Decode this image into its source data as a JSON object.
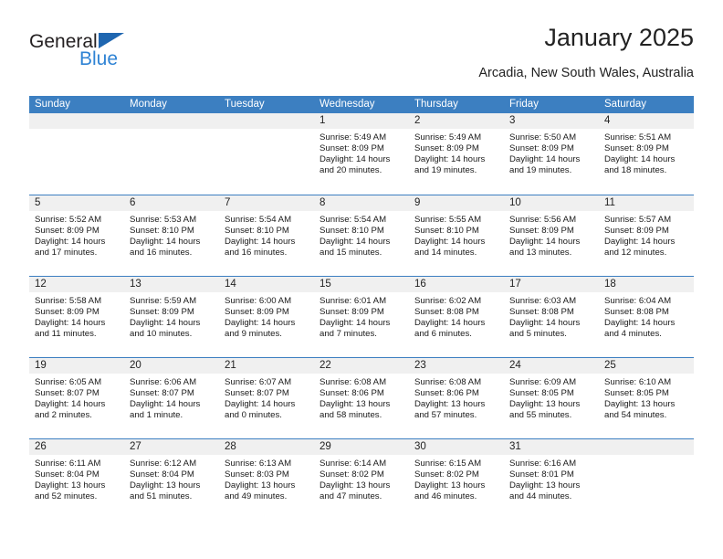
{
  "brand": {
    "word1": "General",
    "word2": "Blue",
    "accent_dark": "#1f66b0",
    "accent_light": "#2f83d4"
  },
  "header": {
    "title": "January 2025",
    "subtitle": "Arcadia, New South Wales, Australia",
    "header_bg": "#3c7fc1"
  },
  "weekdays": [
    "Sunday",
    "Monday",
    "Tuesday",
    "Wednesday",
    "Thursday",
    "Friday",
    "Saturday"
  ],
  "labels": {
    "sunrise": "Sunrise:",
    "sunset": "Sunset:",
    "daylight": "Daylight:"
  },
  "weeks": [
    [
      {
        "day": "",
        "empty": true
      },
      {
        "day": "",
        "empty": true
      },
      {
        "day": "",
        "empty": true
      },
      {
        "day": "1",
        "sunrise": "Sunrise: 5:49 AM",
        "sunset": "Sunset: 8:09 PM",
        "daylight1": "Daylight: 14 hours",
        "daylight2": "and 20 minutes."
      },
      {
        "day": "2",
        "sunrise": "Sunrise: 5:49 AM",
        "sunset": "Sunset: 8:09 PM",
        "daylight1": "Daylight: 14 hours",
        "daylight2": "and 19 minutes."
      },
      {
        "day": "3",
        "sunrise": "Sunrise: 5:50 AM",
        "sunset": "Sunset: 8:09 PM",
        "daylight1": "Daylight: 14 hours",
        "daylight2": "and 19 minutes."
      },
      {
        "day": "4",
        "sunrise": "Sunrise: 5:51 AM",
        "sunset": "Sunset: 8:09 PM",
        "daylight1": "Daylight: 14 hours",
        "daylight2": "and 18 minutes."
      }
    ],
    [
      {
        "day": "5",
        "sunrise": "Sunrise: 5:52 AM",
        "sunset": "Sunset: 8:09 PM",
        "daylight1": "Daylight: 14 hours",
        "daylight2": "and 17 minutes."
      },
      {
        "day": "6",
        "sunrise": "Sunrise: 5:53 AM",
        "sunset": "Sunset: 8:10 PM",
        "daylight1": "Daylight: 14 hours",
        "daylight2": "and 16 minutes."
      },
      {
        "day": "7",
        "sunrise": "Sunrise: 5:54 AM",
        "sunset": "Sunset: 8:10 PM",
        "daylight1": "Daylight: 14 hours",
        "daylight2": "and 16 minutes."
      },
      {
        "day": "8",
        "sunrise": "Sunrise: 5:54 AM",
        "sunset": "Sunset: 8:10 PM",
        "daylight1": "Daylight: 14 hours",
        "daylight2": "and 15 minutes."
      },
      {
        "day": "9",
        "sunrise": "Sunrise: 5:55 AM",
        "sunset": "Sunset: 8:10 PM",
        "daylight1": "Daylight: 14 hours",
        "daylight2": "and 14 minutes."
      },
      {
        "day": "10",
        "sunrise": "Sunrise: 5:56 AM",
        "sunset": "Sunset: 8:09 PM",
        "daylight1": "Daylight: 14 hours",
        "daylight2": "and 13 minutes."
      },
      {
        "day": "11",
        "sunrise": "Sunrise: 5:57 AM",
        "sunset": "Sunset: 8:09 PM",
        "daylight1": "Daylight: 14 hours",
        "daylight2": "and 12 minutes."
      }
    ],
    [
      {
        "day": "12",
        "sunrise": "Sunrise: 5:58 AM",
        "sunset": "Sunset: 8:09 PM",
        "daylight1": "Daylight: 14 hours",
        "daylight2": "and 11 minutes."
      },
      {
        "day": "13",
        "sunrise": "Sunrise: 5:59 AM",
        "sunset": "Sunset: 8:09 PM",
        "daylight1": "Daylight: 14 hours",
        "daylight2": "and 10 minutes."
      },
      {
        "day": "14",
        "sunrise": "Sunrise: 6:00 AM",
        "sunset": "Sunset: 8:09 PM",
        "daylight1": "Daylight: 14 hours",
        "daylight2": "and 9 minutes."
      },
      {
        "day": "15",
        "sunrise": "Sunrise: 6:01 AM",
        "sunset": "Sunset: 8:09 PM",
        "daylight1": "Daylight: 14 hours",
        "daylight2": "and 7 minutes."
      },
      {
        "day": "16",
        "sunrise": "Sunrise: 6:02 AM",
        "sunset": "Sunset: 8:08 PM",
        "daylight1": "Daylight: 14 hours",
        "daylight2": "and 6 minutes."
      },
      {
        "day": "17",
        "sunrise": "Sunrise: 6:03 AM",
        "sunset": "Sunset: 8:08 PM",
        "daylight1": "Daylight: 14 hours",
        "daylight2": "and 5 minutes."
      },
      {
        "day": "18",
        "sunrise": "Sunrise: 6:04 AM",
        "sunset": "Sunset: 8:08 PM",
        "daylight1": "Daylight: 14 hours",
        "daylight2": "and 4 minutes."
      }
    ],
    [
      {
        "day": "19",
        "sunrise": "Sunrise: 6:05 AM",
        "sunset": "Sunset: 8:07 PM",
        "daylight1": "Daylight: 14 hours",
        "daylight2": "and 2 minutes."
      },
      {
        "day": "20",
        "sunrise": "Sunrise: 6:06 AM",
        "sunset": "Sunset: 8:07 PM",
        "daylight1": "Daylight: 14 hours",
        "daylight2": "and 1 minute."
      },
      {
        "day": "21",
        "sunrise": "Sunrise: 6:07 AM",
        "sunset": "Sunset: 8:07 PM",
        "daylight1": "Daylight: 14 hours",
        "daylight2": "and 0 minutes."
      },
      {
        "day": "22",
        "sunrise": "Sunrise: 6:08 AM",
        "sunset": "Sunset: 8:06 PM",
        "daylight1": "Daylight: 13 hours",
        "daylight2": "and 58 minutes."
      },
      {
        "day": "23",
        "sunrise": "Sunrise: 6:08 AM",
        "sunset": "Sunset: 8:06 PM",
        "daylight1": "Daylight: 13 hours",
        "daylight2": "and 57 minutes."
      },
      {
        "day": "24",
        "sunrise": "Sunrise: 6:09 AM",
        "sunset": "Sunset: 8:05 PM",
        "daylight1": "Daylight: 13 hours",
        "daylight2": "and 55 minutes."
      },
      {
        "day": "25",
        "sunrise": "Sunrise: 6:10 AM",
        "sunset": "Sunset: 8:05 PM",
        "daylight1": "Daylight: 13 hours",
        "daylight2": "and 54 minutes."
      }
    ],
    [
      {
        "day": "26",
        "sunrise": "Sunrise: 6:11 AM",
        "sunset": "Sunset: 8:04 PM",
        "daylight1": "Daylight: 13 hours",
        "daylight2": "and 52 minutes."
      },
      {
        "day": "27",
        "sunrise": "Sunrise: 6:12 AM",
        "sunset": "Sunset: 8:04 PM",
        "daylight1": "Daylight: 13 hours",
        "daylight2": "and 51 minutes."
      },
      {
        "day": "28",
        "sunrise": "Sunrise: 6:13 AM",
        "sunset": "Sunset: 8:03 PM",
        "daylight1": "Daylight: 13 hours",
        "daylight2": "and 49 minutes."
      },
      {
        "day": "29",
        "sunrise": "Sunrise: 6:14 AM",
        "sunset": "Sunset: 8:02 PM",
        "daylight1": "Daylight: 13 hours",
        "daylight2": "and 47 minutes."
      },
      {
        "day": "30",
        "sunrise": "Sunrise: 6:15 AM",
        "sunset": "Sunset: 8:02 PM",
        "daylight1": "Daylight: 13 hours",
        "daylight2": "and 46 minutes."
      },
      {
        "day": "31",
        "sunrise": "Sunrise: 6:16 AM",
        "sunset": "Sunset: 8:01 PM",
        "daylight1": "Daylight: 13 hours",
        "daylight2": "and 44 minutes."
      },
      {
        "day": "",
        "empty": true
      }
    ]
  ]
}
